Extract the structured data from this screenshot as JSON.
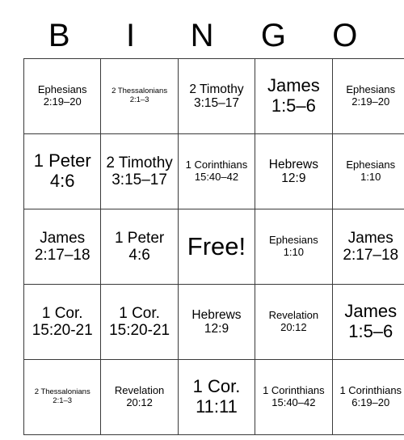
{
  "card": {
    "header_letters": [
      "B",
      "I",
      "N",
      "G",
      "O"
    ],
    "free_space_label": "Free!",
    "grid": [
      [
        {
          "text": "Ephesians 2:19–20",
          "size": "t-sm"
        },
        {
          "text": "2 Thessalonians 2:1–3",
          "size": "t-xs"
        },
        {
          "text": "2 Timothy 3:15–17",
          "size": "t-md"
        },
        {
          "text": "James 1:5–6",
          "size": "t-xl"
        },
        {
          "text": "Ephesians 2:19–20",
          "size": "t-sm"
        }
      ],
      [
        {
          "text": "1 Peter 4:6",
          "size": "t-xl"
        },
        {
          "text": "2 Timothy 3:15–17",
          "size": "t-lg"
        },
        {
          "text": "1 Corinthians 15:40–42",
          "size": "t-sm"
        },
        {
          "text": "Hebrews 12:9",
          "size": "t-md"
        },
        {
          "text": "Ephesians 1:10",
          "size": "t-sm"
        }
      ],
      [
        {
          "text": "James 2:17–18",
          "size": "t-lg"
        },
        {
          "text": "1 Peter 4:6",
          "size": "t-lg"
        },
        {
          "text": "Free!",
          "size": "t-free"
        },
        {
          "text": "Ephesians 1:10",
          "size": "t-sm"
        },
        {
          "text": "James 2:17–18",
          "size": "t-lg"
        }
      ],
      [
        {
          "text": "1 Cor. 15:20-21",
          "size": "t-lg"
        },
        {
          "text": "1 Cor. 15:20-21",
          "size": "t-lg"
        },
        {
          "text": "Hebrews 12:9",
          "size": "t-md"
        },
        {
          "text": "Revelation 20:12",
          "size": "t-sm"
        },
        {
          "text": "James 1:5–6",
          "size": "t-xl"
        }
      ],
      [
        {
          "text": "2 Thessalonians 2:1–3",
          "size": "t-xs"
        },
        {
          "text": "Revelation 20:12",
          "size": "t-sm"
        },
        {
          "text": "1 Cor. 11:11",
          "size": "t-xl"
        },
        {
          "text": "1 Corinthians 15:40–42",
          "size": "t-sm"
        },
        {
          "text": "1 Corinthians 6:19–20",
          "size": "t-sm"
        }
      ]
    ]
  },
  "colors": {
    "background": "#ffffff",
    "text": "#000000",
    "grid_line": "#3a3a3a"
  }
}
